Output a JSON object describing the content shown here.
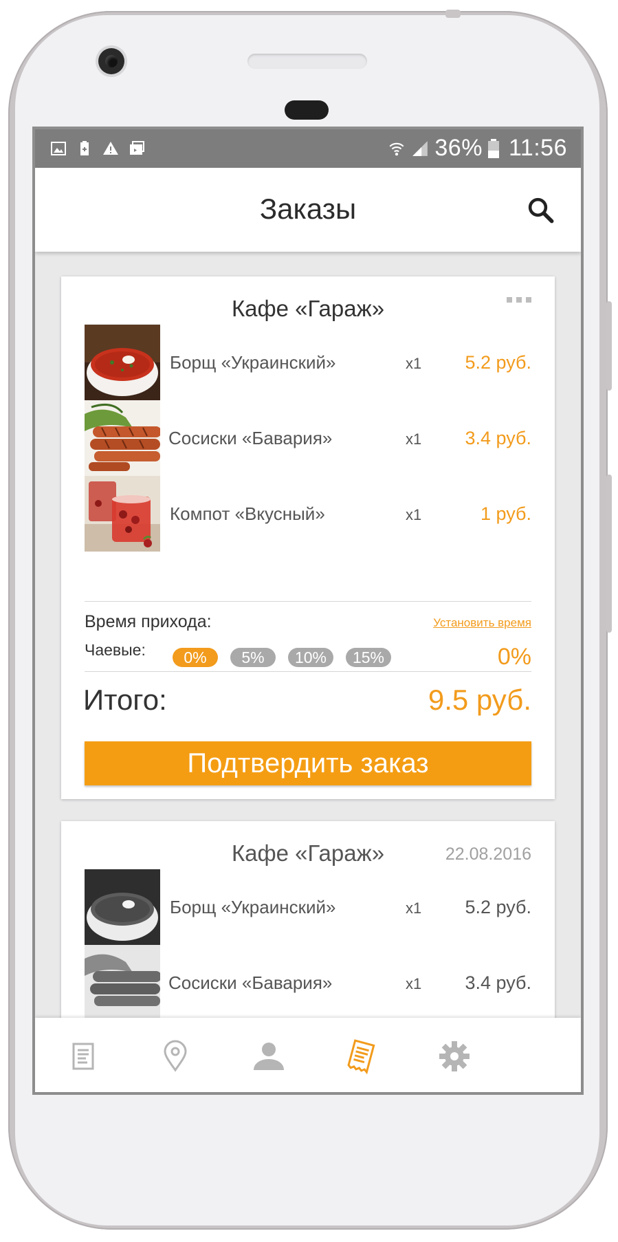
{
  "status_bar": {
    "battery": "36%",
    "time": "11:56",
    "left_icons": [
      "image-icon",
      "battery-saver-icon",
      "warning-icon",
      "photo-library-icon"
    ],
    "right_icons": [
      "wifi-icon",
      "signal-icon",
      "battery-icon"
    ]
  },
  "app_bar": {
    "title": "Заказы",
    "search_icon": "search-icon"
  },
  "active_order": {
    "cafe": "Кафе «Гараж»",
    "menu_icon": "more-icon",
    "items": [
      {
        "name": "Борщ «Украинский»",
        "qty": "x1",
        "price": "5.2 руб.",
        "image": "borscht-photo"
      },
      {
        "name": "Сосиски «Бавария»",
        "qty": "x1",
        "price": "3.4 руб.",
        "image": "sausages-photo"
      },
      {
        "name": "Компот «Вкусный»",
        "qty": "x1",
        "price": "1 руб.",
        "image": "compote-photo"
      }
    ],
    "arrival_label": "Время прихода:",
    "set_time_link": "Установить время",
    "tips_label": "Чаевые:",
    "tip_options": [
      "0%",
      "5%",
      "10%",
      "15%"
    ],
    "selected_tip": "0%",
    "tip_value": "0%",
    "total_label": "Итого:",
    "total_value": "9.5 руб.",
    "confirm_button": "Подтвердить заказ"
  },
  "past_order": {
    "cafe": "Кафе «Гараж»",
    "date": "22.08.2016",
    "items": [
      {
        "name": "Борщ «Украинский»",
        "qty": "x1",
        "price": "5.2 руб.",
        "image": "borscht-photo-grayscale"
      },
      {
        "name": "Сосиски «Бавария»",
        "qty": "x1",
        "price": "3.4 руб.",
        "image": "sausages-photo-grayscale"
      }
    ]
  },
  "bottom_nav": {
    "items": [
      "menu-list-icon",
      "location-pin-icon",
      "profile-icon",
      "orders-icon",
      "settings-gear-icon"
    ],
    "active": "orders-icon",
    "active_color": "#f29b1c",
    "inactive_color": "#b5b5b5"
  },
  "colors": {
    "accent": "#f29b1c",
    "status_bar": "#7d7d7d",
    "screen_bg": "#e9e9ea"
  }
}
